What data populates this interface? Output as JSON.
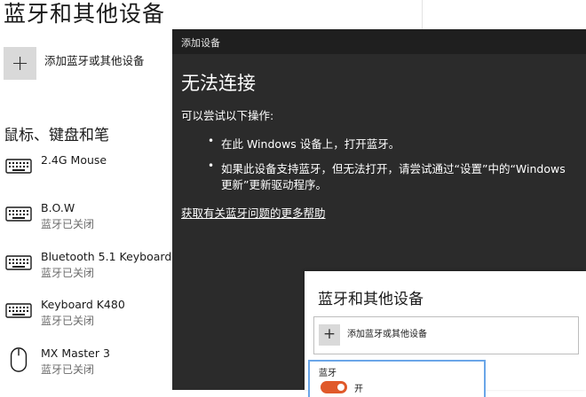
{
  "background": {
    "title": "蓝牙和其他设备",
    "add_label": "添加蓝牙或其他设备",
    "add_symbol": "+",
    "section_title": "鼠标、键盘和笔",
    "devices": [
      {
        "name": "2.4G Mouse",
        "status": "",
        "icon": "keyboard-icon"
      },
      {
        "name": "B.O.W",
        "status": "蓝牙已关闭",
        "icon": "keyboard-icon"
      },
      {
        "name": "Bluetooth 5.1 Keyboard",
        "status": "蓝牙已关闭",
        "icon": "keyboard-icon"
      },
      {
        "name": "Keyboard K480",
        "status": "蓝牙已关闭",
        "icon": "keyboard-icon"
      },
      {
        "name": "MX Master 3",
        "status": "蓝牙已关闭",
        "icon": "mouse-icon"
      }
    ]
  },
  "dialog": {
    "title": "添加设备",
    "heading": "无法连接",
    "subtitle": "可以尝试以下操作:",
    "bullets": [
      {
        "text": "在此 Windows 设备上，打开蓝牙。"
      },
      {
        "line1": "如果此设备支持蓝牙，但无法打开，请尝试通过“设置”中的“Windows",
        "line2": "更新”更新驱动程序。"
      }
    ],
    "bullet_symbol": "•",
    "help_link": "获取有关蓝牙问题的更多帮助"
  },
  "front_panel": {
    "title": "蓝牙和其他设备",
    "add_label": "添加蓝牙或其他设备",
    "add_symbol": "+",
    "bluetooth_label": "蓝牙",
    "toggle_state": "开"
  },
  "colors": {
    "dialog_bg": "#2b2b2b",
    "titlebar_bg": "#1f1f1f",
    "toggle_on": "#e0592a",
    "focus_border": "#6aa6e8"
  }
}
